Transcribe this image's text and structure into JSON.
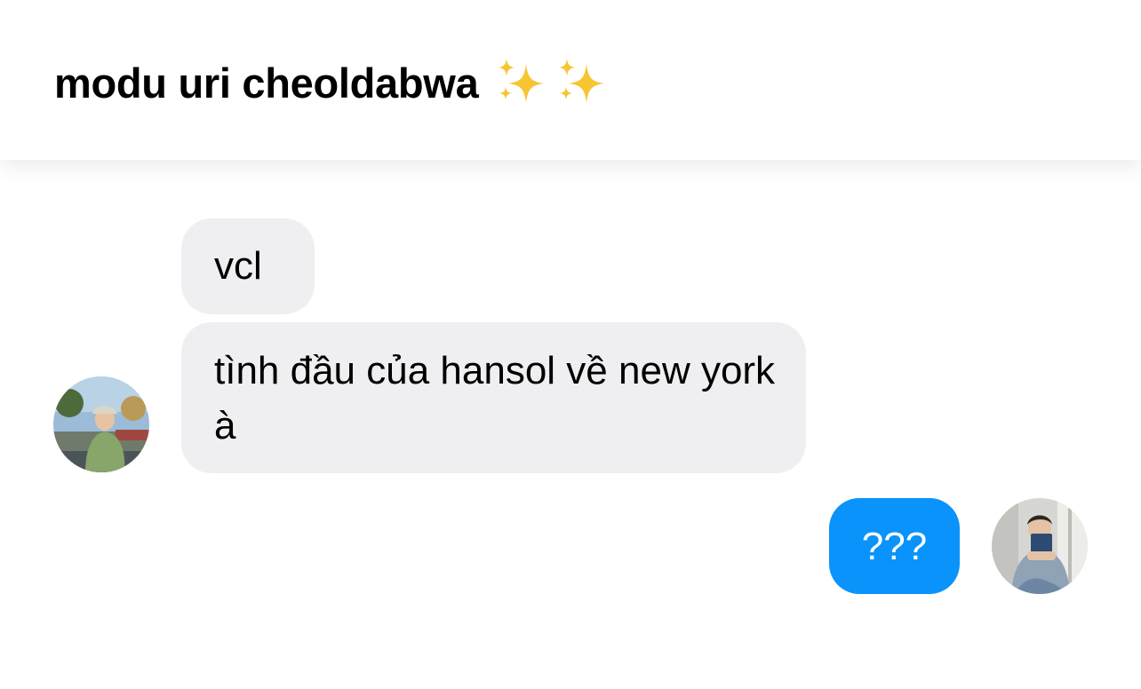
{
  "header": {
    "title": "modu uri cheoldabwa",
    "emoji": [
      "sparkles-emoji",
      "sparkles-emoji"
    ]
  },
  "messages": [
    {
      "sender": "other",
      "text": "vcl"
    },
    {
      "sender": "other",
      "text": "tình đầu của hansol về new york à"
    },
    {
      "sender": "self",
      "text": "???"
    }
  ],
  "colors": {
    "incoming_bubble": "#efeff2",
    "outgoing_bubble": "#0a93fb",
    "sparkle": "#f7c531"
  }
}
